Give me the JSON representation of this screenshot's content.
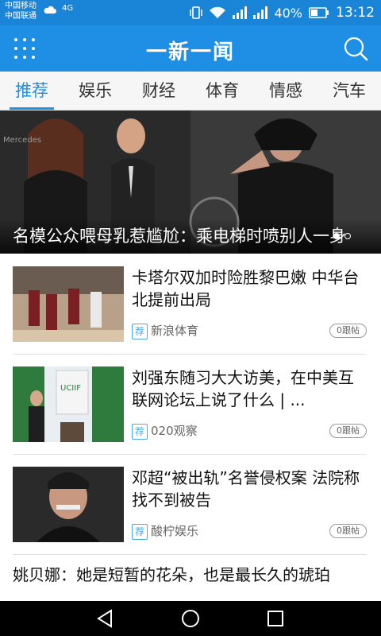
{
  "statusbar": {
    "carrier1": "中国移动",
    "carrier2": "中国联通",
    "hd": "4G",
    "battery": "40%",
    "time": "13:12"
  },
  "app": {
    "title": "一新一闻"
  },
  "tabs": [
    {
      "label": "推荐",
      "active": true
    },
    {
      "label": "娱乐"
    },
    {
      "label": "财经"
    },
    {
      "label": "体育"
    },
    {
      "label": "情感"
    },
    {
      "label": "汽车"
    }
  ],
  "hero": {
    "caption": "名模公众喂母乳惹尴尬：乘电梯时喷别人一身"
  },
  "news": [
    {
      "title": "卡塔尔双加时险胜黎巴嫩 中华台北提前出局",
      "tag": "荐",
      "source": "新浪体育",
      "comments": "0跟帖"
    },
    {
      "title": "刘强东随习大大访美，在中美互联网论坛上说了什么 | ...",
      "tag": "荐",
      "source": "020观察",
      "comments": "0跟帖"
    },
    {
      "title": "邓超“被出轨”名誉侵权案 法院称找不到被告",
      "tag": "荐",
      "source": "酸柠娱乐",
      "comments": "0跟帖"
    }
  ],
  "partial": {
    "title": "姚贝娜：她是短暂的花朵，也是最长久的琥珀"
  }
}
